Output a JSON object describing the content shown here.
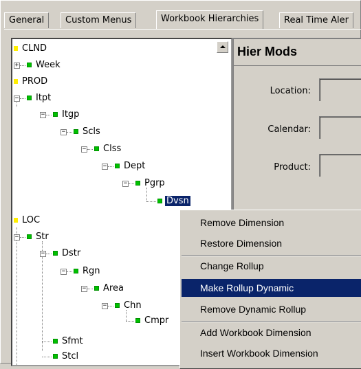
{
  "tabs": [
    "General",
    "Custom Menus",
    "Workbook Hierarchies",
    "Real Time Aler"
  ],
  "tree": {
    "clnd": "CLND",
    "week": "Week",
    "prod": "PROD",
    "itpt": "Itpt",
    "itgp": "Itgp",
    "scls": "Scls",
    "clss": "Clss",
    "dept": "Dept",
    "pgrp": "Pgrp",
    "dvsn": "Dvsn",
    "loc": "LOC",
    "str": "Str",
    "dstr": "Dstr",
    "rgn": "Rgn",
    "area": "Area",
    "chn": "Chn",
    "cmpr": "Cmpr",
    "sfmt": "Sfmt",
    "stcl": "Stcl"
  },
  "panel": {
    "title": "Hier Mods",
    "location_label": "Location:",
    "calendar_label": "Calendar:",
    "product_label": "Product:"
  },
  "menu": {
    "items": [
      "Remove Dimension",
      "Restore Dimension",
      "Change Rollup",
      "Make Rollup Dynamic",
      "Remove Dynamic Rollup",
      "Add Workbook Dimension",
      "Insert Workbook Dimension"
    ]
  },
  "colors": {
    "selection": "#0a246a",
    "level_marker": "#00c000",
    "dimension_marker": "#ffee00"
  }
}
